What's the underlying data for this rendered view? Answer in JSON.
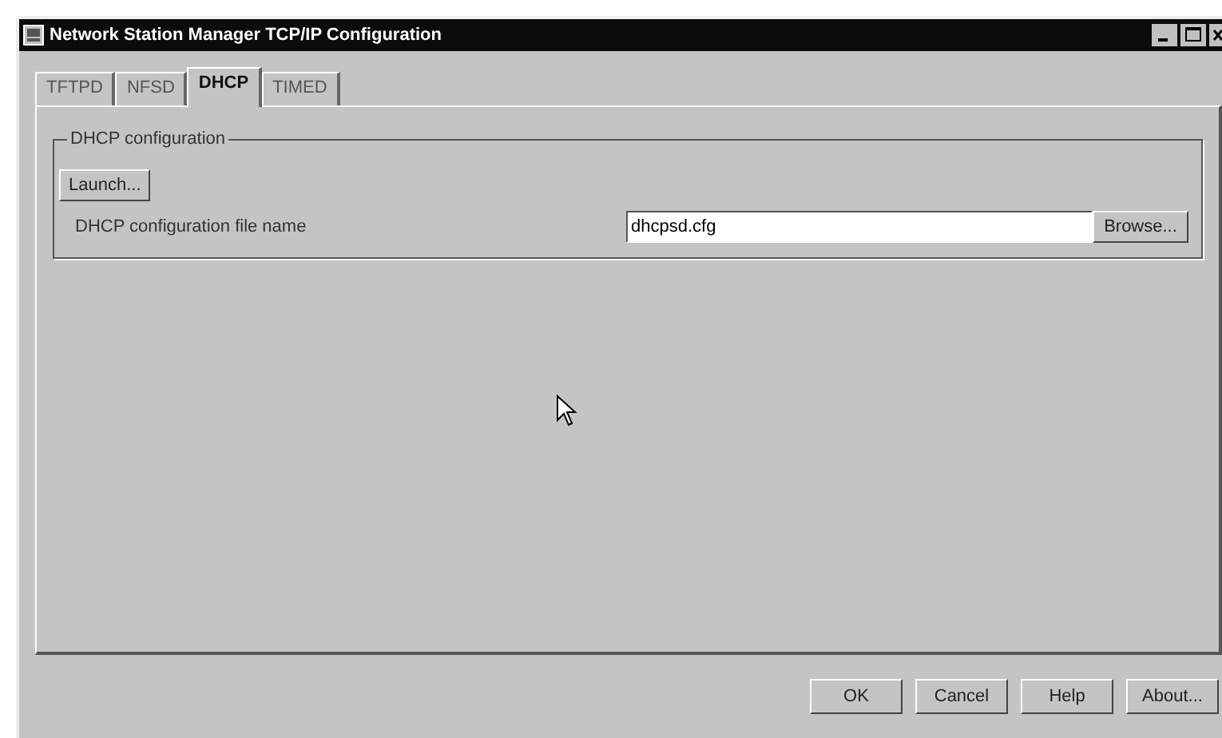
{
  "window": {
    "title": "Network Station Manager TCP/IP Configuration"
  },
  "tabs": [
    {
      "label": "TFTPD",
      "selected": false
    },
    {
      "label": "NFSD",
      "selected": false
    },
    {
      "label": "DHCP",
      "selected": true
    },
    {
      "label": "TIMED",
      "selected": false
    }
  ],
  "group": {
    "title": "DHCP configuration",
    "launch_button": "Launch...",
    "field_label": "DHCP configuration file name",
    "field_value": "dhcpsd.cfg",
    "browse_button": "Browse..."
  },
  "buttons": [
    "OK",
    "Cancel",
    "Help",
    "About..."
  ]
}
